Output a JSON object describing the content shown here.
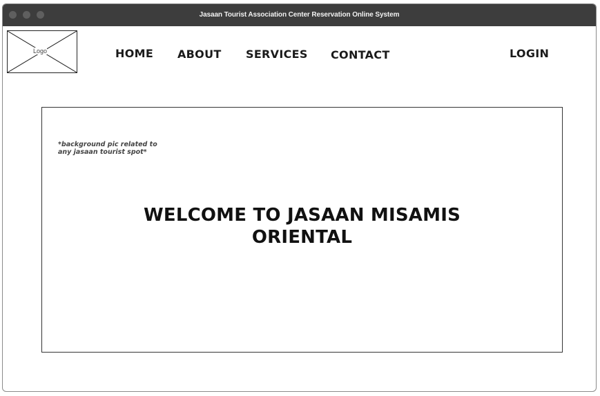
{
  "window": {
    "title": "Jasaan Tourist Association Center Reservation Online System"
  },
  "header": {
    "logo_label": "Logo",
    "nav": {
      "home": "HOME",
      "about": "ABOUT",
      "services": "SERVICES",
      "contact": "CONTACT"
    },
    "login_label": "LOGIN"
  },
  "hero": {
    "note": "*background pic related to\nany jasaan tourist spot*",
    "heading": "WELCOME TO JASAAN MISAMIS\nORIENTAL"
  },
  "colors": {
    "titlebar": "#3d3d3d",
    "traffic_light": "#5f5f5f",
    "text": "#1a1a1a",
    "border": "#333333"
  }
}
